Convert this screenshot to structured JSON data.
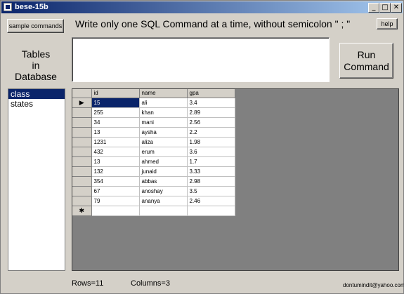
{
  "window": {
    "title": "bese-15b",
    "minimize_glyph": "_",
    "maximize_glyph": "□",
    "close_glyph": "✕"
  },
  "toolbar": {
    "sample_label": "sample commands",
    "instructions": "Write only one SQL Command at a time, without semicolon \" ; \"",
    "help_label": "help",
    "run_label_line1": "Run",
    "run_label_line2": "Command"
  },
  "sidebar": {
    "heading_line1": "Tables",
    "heading_line2": "in",
    "heading_line3": "Database",
    "items": [
      {
        "label": "class",
        "selected": true
      },
      {
        "label": "states",
        "selected": false
      }
    ]
  },
  "sql_input": {
    "value": ""
  },
  "grid": {
    "columns": [
      "id",
      "name",
      "gpa"
    ],
    "rows": [
      [
        "15",
        "ali",
        "3.4"
      ],
      [
        "255",
        "khan",
        "2.89"
      ],
      [
        "34",
        "mani",
        "2.56"
      ],
      [
        "13",
        "aysha",
        "2.2"
      ],
      [
        "1231",
        "aliza",
        "1.98"
      ],
      [
        "432",
        "erum",
        "3.6"
      ],
      [
        "13",
        "ahmed",
        "1.7"
      ],
      [
        "132",
        "junaid",
        "3.33"
      ],
      [
        "354",
        "abbas",
        "2.98"
      ],
      [
        "67",
        "anoshay",
        "3.5"
      ],
      [
        "79",
        "ananya",
        "2.46"
      ]
    ],
    "current_row_glyph": "▶",
    "new_row_glyph": "✱"
  },
  "status": {
    "rows_text": "Rows=11",
    "columns_text": "Columns=3",
    "email": "dontumindit@yahoo.com"
  },
  "colors": {
    "selection": "#0a246a",
    "window_bg": "#d4d0c8",
    "grid_bg": "#808080"
  }
}
